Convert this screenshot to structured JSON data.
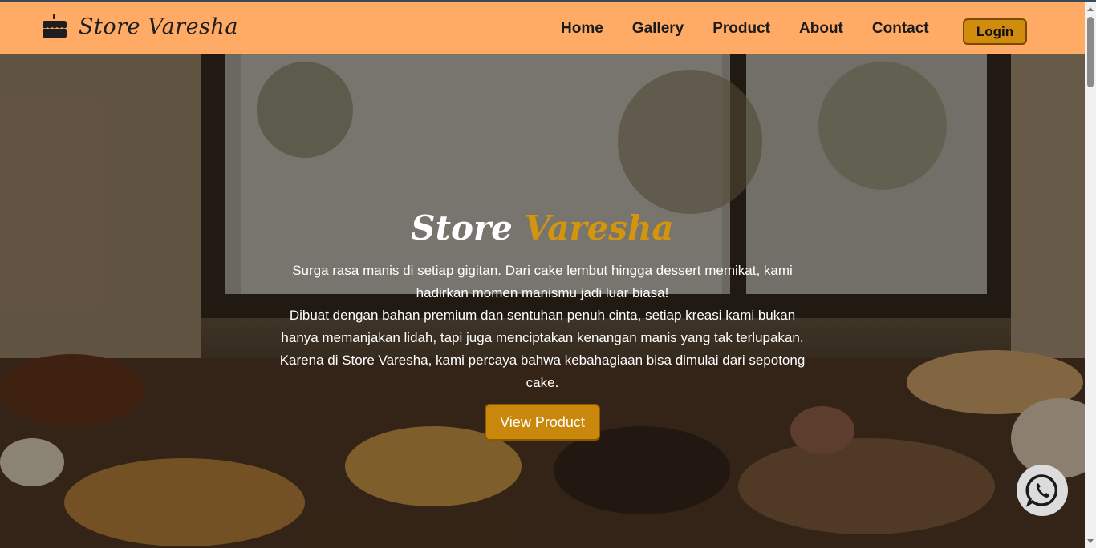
{
  "brand": {
    "name": "Store Varesha",
    "icon": "cake-icon"
  },
  "nav": {
    "links": [
      "Home",
      "Gallery",
      "Product",
      "About",
      "Contact"
    ],
    "login_label": "Login"
  },
  "hero": {
    "title_part1": "Store",
    "title_part2": "Varesha",
    "paragraph1": "Surga rasa manis di setiap gigitan. Dari cake lembut hingga dessert memikat, kami hadirkan momen manismu jadi luar biasa!",
    "paragraph2": "Dibuat dengan bahan premium dan sentuhan penuh cinta, setiap kreasi kami bukan hanya memanjakan lidah, tapi juga menciptakan kenangan manis yang tak terlupakan. Karena di Store Varesha, kami percaya bahwa kebahagiaan bisa dimulai dari sepotong cake.",
    "button_label": "View Product"
  },
  "floating": {
    "icon": "whatsapp-icon"
  },
  "colors": {
    "navbar": "#ffab66",
    "accent_gold": "#d4950e",
    "button": "#c9880c"
  }
}
